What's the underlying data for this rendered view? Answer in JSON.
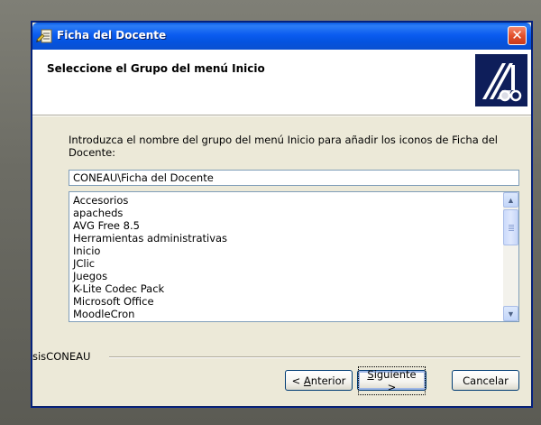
{
  "window": {
    "title": "Ficha del Docente",
    "close_symbol": "✕"
  },
  "header": {
    "title": "Seleccione el Grupo del menú Inicio",
    "logo_icon": "coneau-logo"
  },
  "instruction": "Introduzca el nombre del grupo del menú Inicio para añadir los iconos de Ficha del Docente:",
  "group_input": {
    "value": "CONEAU\\Ficha del Docente"
  },
  "group_list": {
    "items": [
      "Accesorios",
      "apacheds",
      "AVG Free 8.5",
      "Herramientas administrativas",
      "Inicio",
      "JClic",
      "Juegos",
      "K-Lite Codec Pack",
      "Microsoft Office",
      "MoodleCron"
    ]
  },
  "footer": {
    "brand": "sisCONEAU",
    "back_prefix": "< ",
    "back_accel": "A",
    "back_rest": "nterior",
    "next_accel": "S",
    "next_rest": "iguiente >",
    "cancel": "Cancelar"
  },
  "colors": {
    "titlebar": "#0b5cf0",
    "close": "#e3512c",
    "face": "#ece9d8"
  }
}
